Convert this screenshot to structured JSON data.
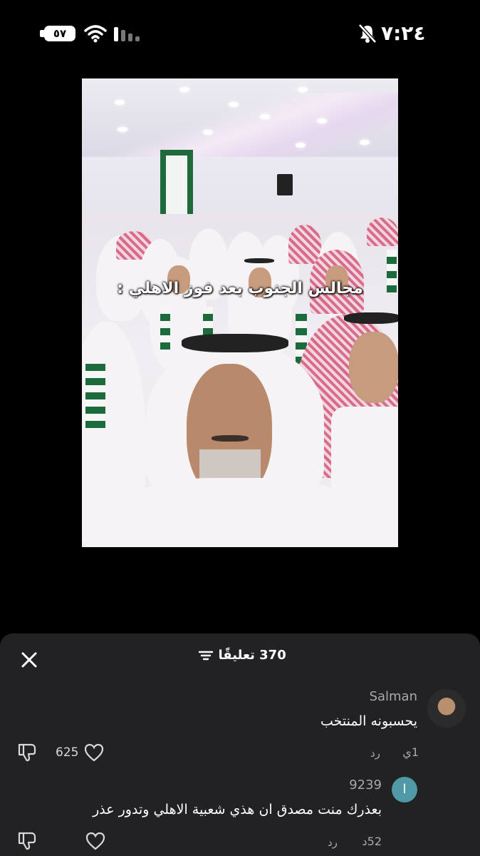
{
  "status_bar": {
    "battery": "٥٧",
    "time": "٧:٢٤",
    "icons": [
      "battery-icon",
      "wifi-icon",
      "signal-icon",
      "mute-bell-icon"
    ]
  },
  "video": {
    "caption": "مجالس الجنوب بعد فوز الاهلي :"
  },
  "comments": {
    "count_label": "370 تعليقًا",
    "items": [
      {
        "username": "Salman",
        "text": "يحسبونه المنتخب",
        "time": "1ي",
        "reply_label": "رد",
        "likes": "625"
      },
      {
        "username": "9239",
        "avatar_letter": "ا",
        "text": "بعذرك منت مصدق ان هذي شعبية الاهلي وتدور عذر",
        "time": "52د",
        "reply_label": "رد",
        "likes": ""
      }
    ]
  },
  "colors": {
    "sheet_bg": "#222224",
    "avatar_teal": "#4f9aa6",
    "muted_text": "#a9a9ad"
  }
}
